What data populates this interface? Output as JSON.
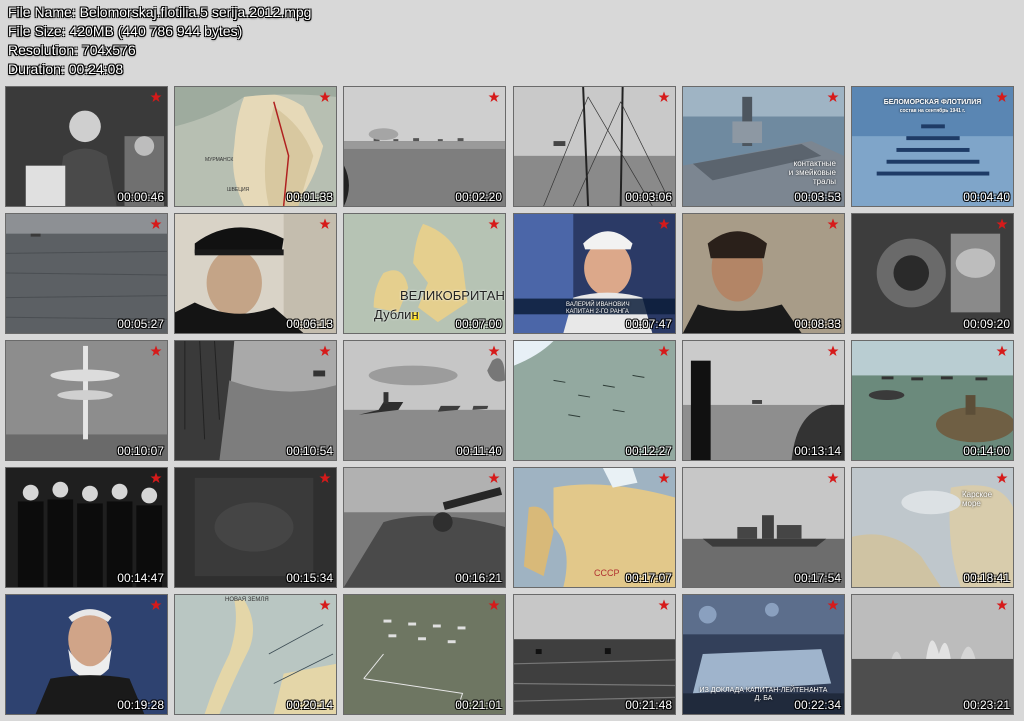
{
  "header": {
    "file_name": "File Name: Belomorskaj.flotilia.5 serija.2012.mpg",
    "file_size": "File Size: 420MB (440 786 944 bytes)",
    "resolution": "Resolution: 704x576",
    "duration": "Duration: 00:24:08"
  },
  "thumbnails": [
    {
      "time": "00:00:46",
      "scene": "speaker",
      "icon": "star-icon"
    },
    {
      "time": "00:01:33",
      "scene": "map-scandinavia",
      "icon": "star-icon",
      "labels": [
        "МУРМАНСК",
        "ШВЕЦИЯ"
      ]
    },
    {
      "time": "00:02:20",
      "scene": "sea-convoy-haze",
      "icon": "star-icon"
    },
    {
      "time": "00:03:06",
      "scene": "ship-masts",
      "icon": "star-icon"
    },
    {
      "time": "00:03:53",
      "scene": "render-trawler",
      "icon": "star-icon",
      "labels": [
        "контактные",
        "и змейковые",
        "тралы"
      ]
    },
    {
      "time": "00:04:40",
      "scene": "fleet-diagram",
      "icon": "star-icon",
      "labels": [
        "БЕЛОМОРСКАЯ ФЛОТИЛИЯ",
        "состав на сентябрь 1941 г."
      ]
    },
    {
      "time": "00:05:27",
      "scene": "dark-sea",
      "icon": "star-icon"
    },
    {
      "time": "00:06:13",
      "scene": "officer-profile",
      "icon": "star-icon"
    },
    {
      "time": "00:07:00",
      "scene": "map-britain",
      "icon": "star-icon",
      "labels": [
        "ВЕЛИКОБРИТАН",
        "Дублин"
      ]
    },
    {
      "time": "00:07:47",
      "scene": "interview-white-cap",
      "icon": "star-icon",
      "labels": [
        "ВАЛЕРИЙ ИВАНОВИЧ",
        "КАПИТАН 2-ГО РАНГА"
      ]
    },
    {
      "time": "00:08:33",
      "scene": "young-officer",
      "icon": "star-icon"
    },
    {
      "time": "00:09:20",
      "scene": "engine-room",
      "icon": "star-icon"
    },
    {
      "time": "00:10:07",
      "scene": "water-column",
      "icon": "star-icon"
    },
    {
      "time": "00:10:54",
      "scene": "harbor-aerial",
      "icon": "star-icon"
    },
    {
      "time": "00:11:40",
      "scene": "convoy-smoke",
      "icon": "star-icon"
    },
    {
      "time": "00:12:27",
      "scene": "map-sea-arrows",
      "icon": "star-icon"
    },
    {
      "time": "00:13:14",
      "scene": "periscope-view",
      "icon": "star-icon"
    },
    {
      "time": "00:14:00",
      "scene": "submarine-render",
      "icon": "star-icon"
    },
    {
      "time": "00:14:47",
      "scene": "officers-group",
      "icon": "star-icon"
    },
    {
      "time": "00:15:34",
      "scene": "dark-frame",
      "icon": "star-icon"
    },
    {
      "time": "00:16:21",
      "scene": "sub-deck-gun",
      "icon": "star-icon"
    },
    {
      "time": "00:17:07",
      "scene": "map-ussr",
      "icon": "star-icon",
      "labels": [
        "СССР"
      ]
    },
    {
      "time": "00:17:54",
      "scene": "warship-sea",
      "icon": "star-icon"
    },
    {
      "time": "00:18:41",
      "scene": "map-white-sea",
      "icon": "star-icon",
      "labels": [
        "Карское",
        "море"
      ]
    },
    {
      "time": "00:19:28",
      "scene": "veteran-interview",
      "icon": "star-icon"
    },
    {
      "time": "00:20:14",
      "scene": "map-novaya-zemlya",
      "icon": "star-icon",
      "labels": [
        "НОВАЯ ЗЕМЛЯ"
      ]
    },
    {
      "time": "00:21:01",
      "scene": "map-formation",
      "icon": "star-icon"
    },
    {
      "time": "00:21:48",
      "scene": "stormy-sea",
      "icon": "star-icon"
    },
    {
      "time": "00:22:34",
      "scene": "ship-interior-text",
      "icon": "star-icon",
      "labels": [
        "ИЗ ДОКЛАДА КАПИТАН-ЛЕЙТЕНАНТА",
        "Д. БА"
      ]
    },
    {
      "time": "00:23:21",
      "scene": "explosions-sea",
      "icon": "star-icon"
    }
  ],
  "colors": {
    "background": "#d8d8d8",
    "star": "#d61a1a",
    "timestamp": "#ffffff"
  }
}
